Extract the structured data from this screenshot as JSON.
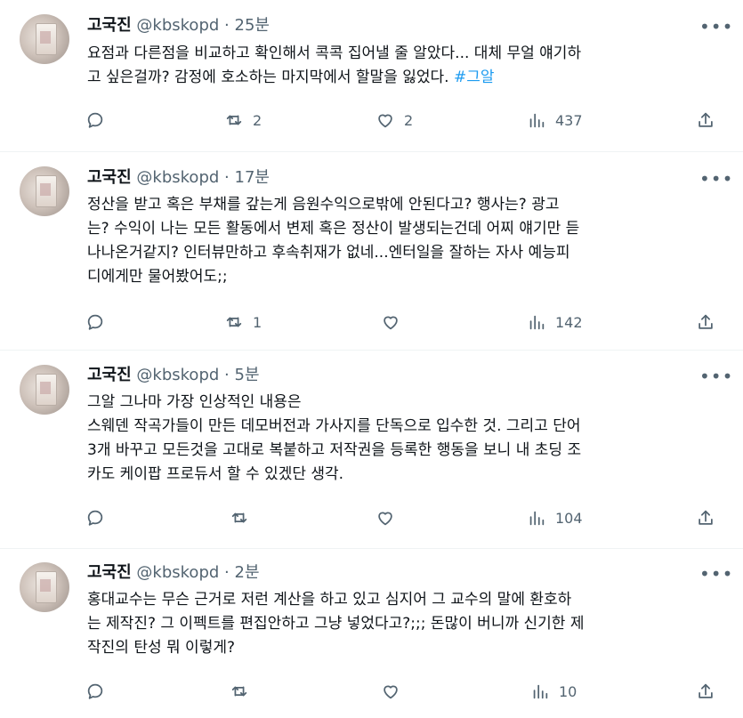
{
  "tweets": [
    {
      "name": "고국진",
      "handle": "@kbskopd",
      "separator": "·",
      "time": "25분",
      "lines": [
        "요점과 다른점을 비교하고 확인해서 콕콕 집어낼 줄 알았다... 대체 무얼 얘기하",
        "고 싶은걸까? 감정에 호소하는 마지막에서 할말을 잃었다."
      ],
      "hashtag": "#그알",
      "replies": "",
      "retweets": "2",
      "likes": "2",
      "views": "437"
    },
    {
      "name": "고국진",
      "handle": "@kbskopd",
      "separator": "·",
      "time": "17분",
      "lines": [
        "정산을 받고 혹은 부채를 갚는게 음원수익으로밖에 안된다고? 행사는? 광고",
        "는? 수익이 나는 모든 활동에서 변제 혹은 정산이 발생되는건데 어찌 얘기만 듣",
        "나나온거같지? 인터뷰만하고 후속취재가 없네...엔터일을 잘하는 자사 예능피",
        "디에게만 물어봤어도;;"
      ],
      "replies": "",
      "retweets": "1",
      "likes": "",
      "views": "142"
    },
    {
      "name": "고국진",
      "handle": "@kbskopd",
      "separator": "·",
      "time": "5분",
      "lines": [
        "그알 그나마 가장 인상적인 내용은",
        "스웨덴 작곡가들이 만든 데모버전과 가사지를 단독으로 입수한 것. 그리고 단어",
        "3개 바꾸고 모든것을 고대로 복붙하고 저작권을 등록한 행동을 보니 내 초딩 조",
        "카도 케이팝 프로듀서 할 수 있겠단 생각."
      ],
      "replies": "",
      "retweets": "",
      "likes": "",
      "views": "104"
    },
    {
      "name": "고국진",
      "handle": "@kbskopd",
      "separator": "·",
      "time": "2분",
      "lines": [
        "홍대교수는 무슨 근거로 저런 계산을 하고 있고 심지어 그 교수의 말에 환호하",
        "는 제작진? 그 이펙트를 편집안하고 그냥 넣었다고?;;; 돈많이 버니까 신기한 제",
        "작진의 탄성 뭐 이렇게?"
      ],
      "replies": "",
      "retweets": "",
      "likes": "",
      "views": "10"
    }
  ],
  "icons": {
    "reply": "reply-icon",
    "retweet": "retweet-icon",
    "like": "heart-icon",
    "views": "views-icon",
    "share": "share-icon",
    "more": "more-icon"
  },
  "colors": {
    "text": "#0f1419",
    "secondary": "#536471",
    "link": "#1d9bf0",
    "divider": "#eff3f4"
  }
}
